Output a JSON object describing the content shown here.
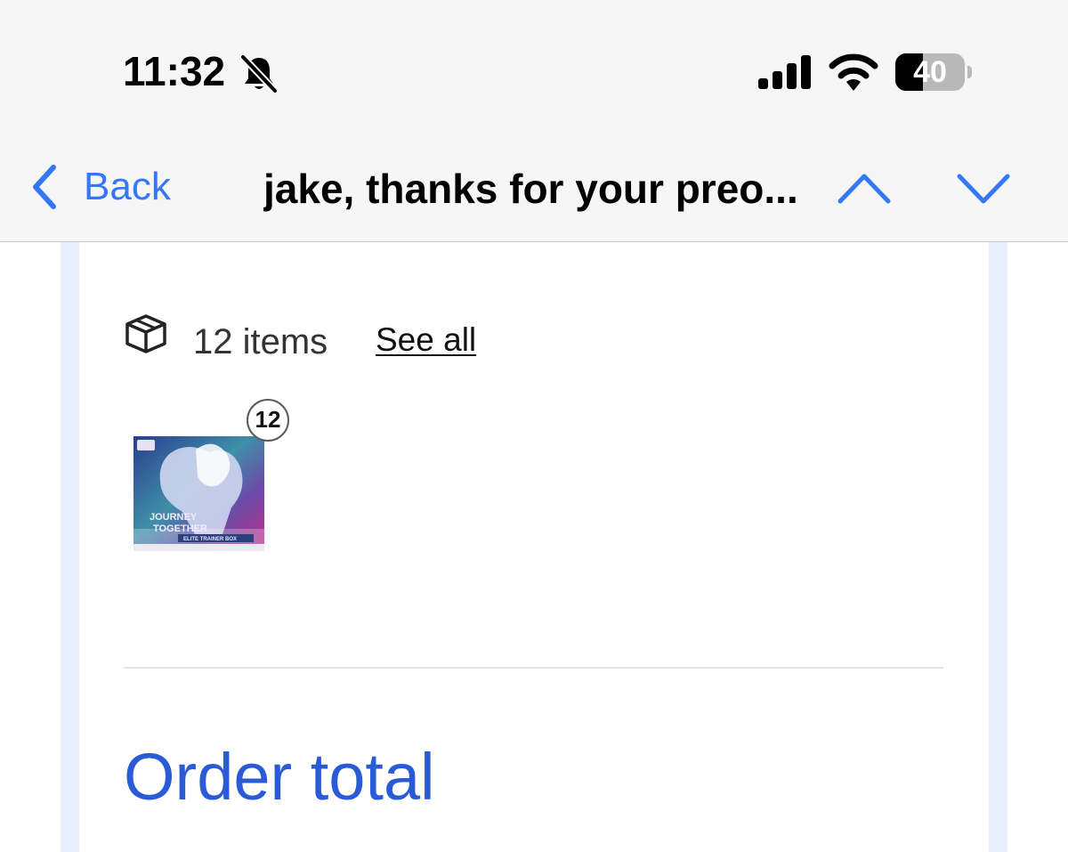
{
  "status_bar": {
    "time": "11:32",
    "battery_percent": "40",
    "battery_level": 0.4,
    "icons": [
      "bell-slash-icon",
      "cellular-signal-icon",
      "wifi-icon",
      "battery-icon"
    ]
  },
  "nav": {
    "back_label": "Back",
    "title": "jake, thanks for your preo...",
    "up_icon": "chevron-up-icon",
    "down_icon": "chevron-down-icon"
  },
  "order": {
    "box_icon": "package-box-icon",
    "items_count": "12 items",
    "see_all": "See all",
    "product": {
      "quantity": "12",
      "image_text": [
        "JOURNEY",
        "TOGETHER",
        "ELITE TRAINER BOX"
      ]
    },
    "order_total_heading": "Order total"
  },
  "colors": {
    "accent": "#3478f6",
    "heading_blue": "#2a5bd7",
    "frame": "#e6effb"
  }
}
